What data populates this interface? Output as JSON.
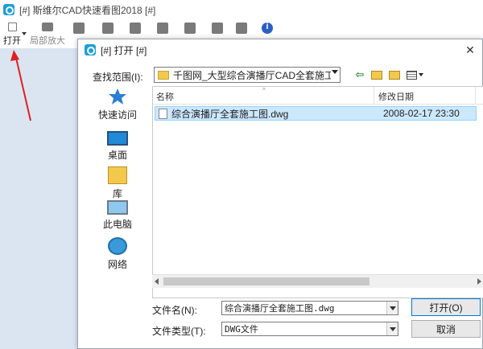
{
  "app": {
    "title": "[#] 斯维尔CAD快速看图2018 [#]",
    "toolbar": {
      "open_label": "打开",
      "zoom_label": "局部放大"
    }
  },
  "dialog": {
    "title": "[#] 打开 [#]",
    "close_glyph": "✕",
    "lookin_label": "查找范围(I):",
    "lookin_value": "千图网_大型综合演播厅CAD全套施工图dw",
    "places": [
      {
        "label": "快速访问",
        "icon": "star-icon"
      },
      {
        "label": "桌面",
        "icon": "desktop-icon"
      },
      {
        "label": "库",
        "icon": "library-icon"
      },
      {
        "label": "此电脑",
        "icon": "computer-icon"
      },
      {
        "label": "网络",
        "icon": "network-icon"
      }
    ],
    "columns": {
      "name": "名称",
      "modified": "修改日期"
    },
    "files": [
      {
        "name": "综合演播厅全套施工图.dwg",
        "modified": "2008-02-17 23:30"
      }
    ],
    "filename_label": "文件名(N):",
    "filename_value": "综合演播厅全套施工图.dwg",
    "filetype_label": "文件类型(T):",
    "filetype_value": "DWG文件",
    "open_button": "打开(O)",
    "cancel_button": "取消"
  },
  "colors": {
    "accent": "#0078d7",
    "selection": "#cce8ff",
    "annotation_arrow": "#e02020"
  }
}
